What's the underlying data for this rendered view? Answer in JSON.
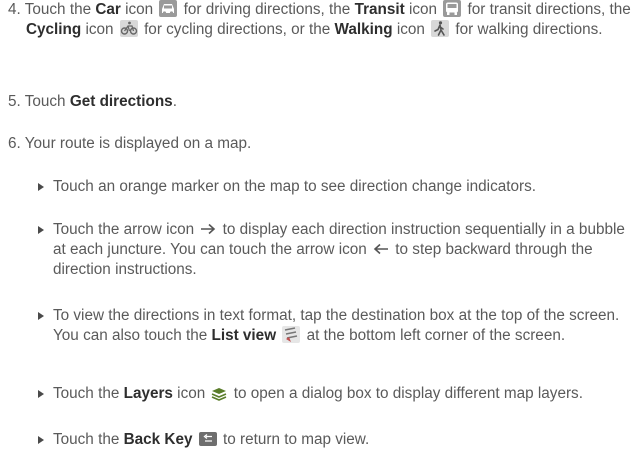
{
  "steps": {
    "s4": {
      "num": "4.",
      "t1": "Touch the",
      "car": "Car",
      "t2": "icon",
      "t3": "for driving directions, the",
      "transit": "Transit",
      "t4": "icon",
      "t5": "for transit directions, the",
      "cycling": "Cycling",
      "t6": "icon",
      "t7": "for cycling directions, or the",
      "walking": "Walking",
      "t8": "icon",
      "t9": "for walking directions."
    },
    "s5": {
      "num": "5.",
      "t1": "Touch",
      "b1": "Get directions",
      "t2": "."
    },
    "s6": {
      "num": "6.",
      "t1": "Your route is displayed on a map."
    }
  },
  "bullets": {
    "b1": {
      "t1": "Touch an orange marker on the map to see direction change indicators."
    },
    "b2": {
      "t1": "Touch the arrow icon",
      "t2": "to display each direction instruction sequentially in a bubble at each juncture. You can touch the arrow icon",
      "t3": "to step backward through the direction instructions."
    },
    "b3": {
      "t1": "To view the directions in text format, tap the destination box at the top of the screen. You can also touch the",
      "bold": "List view",
      "t2": "at the bottom left corner of the screen."
    },
    "b4": {
      "t1": "Touch the",
      "bold": "Layers",
      "t2": "icon",
      "t3": "to open a dialog box to display different map layers."
    },
    "b5": {
      "t1": "Touch the",
      "bold": "Back Key",
      "t2": "to return to map view."
    }
  },
  "icons": {
    "car": "car-icon",
    "transit": "transit-bus-icon",
    "cycling": "bicycle-icon",
    "walking": "walking-person-icon",
    "arrow_right": "arrow-right-icon",
    "arrow_left": "arrow-left-icon",
    "list_view": "list-view-icon",
    "layers": "layers-icon",
    "back_key": "back-key-icon"
  },
  "colors": {
    "text": "#5a5a5a",
    "bold_text": "#2e2e2e",
    "icon_gray": "#8c8c8c",
    "layers_green": "#5a7d2a"
  }
}
